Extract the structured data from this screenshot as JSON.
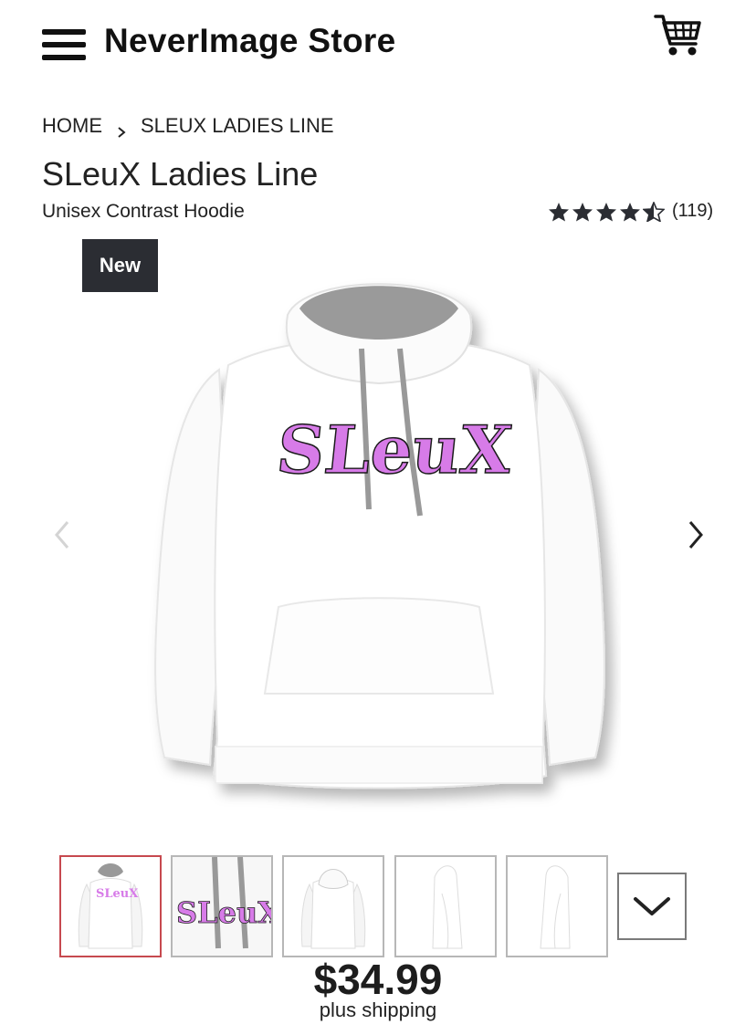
{
  "header": {
    "store_name": "NeverImage Store",
    "menu_icon": "hamburger-menu-icon",
    "cart_icon": "shopping-cart-icon"
  },
  "breadcrumb": {
    "items": [
      "HOME",
      "SLEUX LADIES LINE"
    ],
    "separator_icon": "chevron-right-icon"
  },
  "product": {
    "title": "SLeuX Ladies Line",
    "subtitle": "Unisex Contrast Hoodie",
    "rating": {
      "stars": 4.5,
      "max": 5,
      "count_label": "(119)",
      "star_color": "#2b2d33"
    },
    "badge": "New",
    "print_text": "SLeuX",
    "colors": {
      "body": "#ffffff",
      "hood_lining": "#9a9a9a",
      "print": "#d77be8",
      "badge_bg": "#2b2d33",
      "active_thumb_border": "#c7494f"
    },
    "price": "$34.99",
    "shipping_note": "plus shipping"
  },
  "gallery": {
    "prev_icon": "chevron-left-icon",
    "next_icon": "chevron-right-icon",
    "thumbnails": [
      "front",
      "print-closeup",
      "back",
      "left-side",
      "right-side"
    ],
    "active_index": 0,
    "more_icon": "chevron-down-icon"
  }
}
